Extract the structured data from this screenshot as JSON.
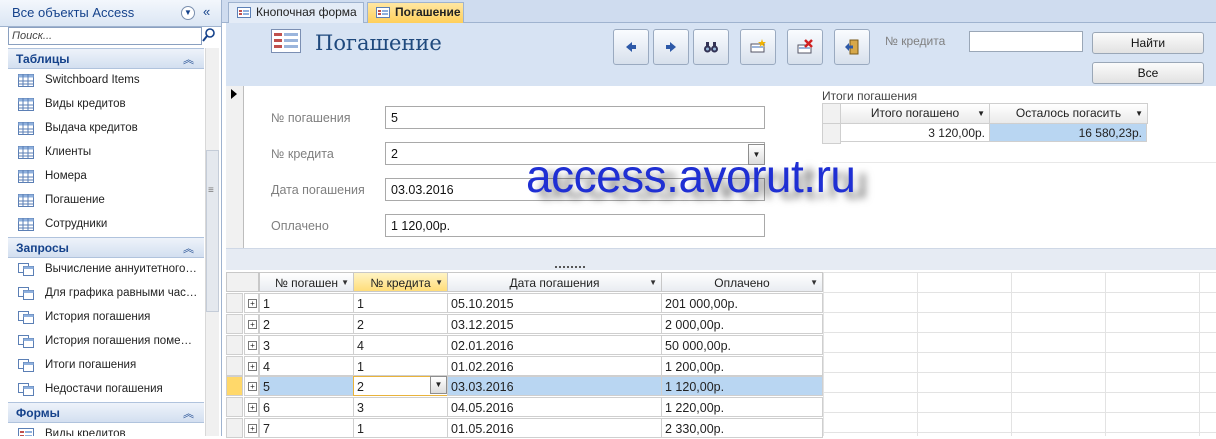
{
  "nav": {
    "title": "Все объекты Access",
    "search_placeholder": "Поиск...",
    "groups": [
      {
        "title": "Таблицы",
        "items": [
          "Switchboard Items",
          "Виды кредитов",
          "Выдача кредитов",
          "Клиенты",
          "Номера",
          "Погашение",
          "Сотрудники"
        ]
      },
      {
        "title": "Запросы",
        "items": [
          "Вычисление аннуитетного…",
          "Для графика равными час…",
          "История погашения",
          "История погашения поме…",
          "Итоги погашения",
          "Недостачи погашения"
        ]
      },
      {
        "title": "Формы",
        "items": [
          "Виды кредитов"
        ]
      }
    ]
  },
  "tabs": [
    {
      "label": "Кнопочная форма",
      "active": false
    },
    {
      "label": "Погашение",
      "active": true
    }
  ],
  "form": {
    "title": "Погашение",
    "search_label": "№ кредита",
    "search_value": "",
    "find_button": "Найти",
    "all_button": "Все",
    "fields": [
      {
        "label": "№ погашения",
        "value": "5"
      },
      {
        "label": "№ кредита",
        "value": "2"
      },
      {
        "label": "Дата погашения",
        "value": "03.03.2016"
      },
      {
        "label": "Оплачено",
        "value": "1 120,00р."
      }
    ],
    "totals": {
      "title": "Итоги погашения",
      "headers": [
        "Итого погашено",
        "Осталось погасить"
      ],
      "values": [
        "3 120,00р.",
        "16 580,23р."
      ]
    }
  },
  "watermark": "access.avorut.ru",
  "datasheet": {
    "headers": [
      "№ погашен",
      "№ кредита",
      "Дата погашения",
      "Оплачено"
    ],
    "rows": [
      [
        "1",
        "1",
        "05.10.2015",
        "201 000,00р."
      ],
      [
        "2",
        "2",
        "03.12.2015",
        "2 000,00р."
      ],
      [
        "3",
        "4",
        "02.01.2016",
        "50 000,00р."
      ],
      [
        "4",
        "1",
        "01.02.2016",
        "1 200,00р."
      ],
      [
        "5",
        "2",
        "03.03.2016",
        "1 120,00р."
      ],
      [
        "6",
        "3",
        "04.05.2016",
        "1 220,00р."
      ],
      [
        "7",
        "1",
        "01.05.2016",
        "2 330,00р."
      ]
    ],
    "current_row": 5
  }
}
